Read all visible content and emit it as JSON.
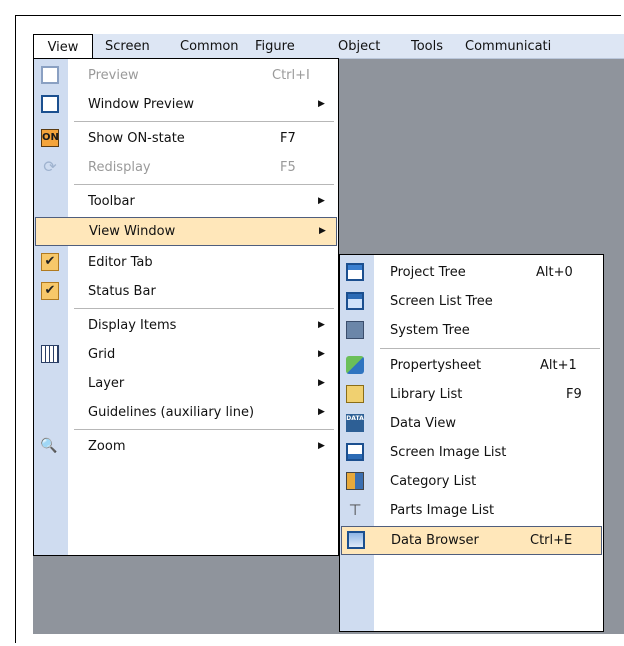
{
  "menubar": {
    "items": [
      "View",
      "Screen",
      "Common",
      "Figure",
      "Object",
      "Tools",
      "Communicati"
    ]
  },
  "view_menu": {
    "items": [
      {
        "label": "Preview",
        "shortcut": "Ctrl+I",
        "icon": "preview-icon",
        "disabled": true
      },
      {
        "label": "Window Preview",
        "submenu": true,
        "icon": "window-preview-icon"
      },
      {
        "label": "Show ON-state",
        "shortcut": "F7",
        "icon": "on-state-icon",
        "icon_text": "ON"
      },
      {
        "label": "Redisplay",
        "shortcut": "F5",
        "icon": "redisplay-icon",
        "disabled": true
      },
      {
        "label": "Toolbar",
        "submenu": true
      },
      {
        "label": "View Window",
        "submenu": true,
        "highlighted": true
      },
      {
        "label": "Editor Tab",
        "checked": true,
        "icon": "checkmark-icon"
      },
      {
        "label": "Status Bar",
        "checked": true,
        "icon": "checkmark-icon"
      },
      {
        "label": "Display Items",
        "submenu": true
      },
      {
        "label": "Grid",
        "submenu": true,
        "icon": "grid-icon"
      },
      {
        "label": "Layer",
        "submenu": true
      },
      {
        "label": "Guidelines (auxiliary line)",
        "submenu": true
      },
      {
        "label": "Zoom",
        "submenu": true,
        "icon": "zoom-icon"
      }
    ]
  },
  "view_window_submenu": {
    "items": [
      {
        "label": "Project Tree",
        "shortcut": "Alt+0",
        "icon": "project-tree-icon"
      },
      {
        "label": "Screen List Tree",
        "icon": "screen-list-tree-icon"
      },
      {
        "label": "System Tree",
        "icon": "system-tree-icon"
      },
      {
        "label": "Propertysheet",
        "shortcut": "Alt+1",
        "icon": "propertysheet-icon"
      },
      {
        "label": "Library List",
        "shortcut": "F9",
        "icon": "library-list-icon"
      },
      {
        "label": "Data View",
        "icon": "data-view-icon",
        "icon_text": "DATA"
      },
      {
        "label": "Screen Image List",
        "icon": "screen-image-list-icon"
      },
      {
        "label": "Category List",
        "icon": "category-list-icon"
      },
      {
        "label": "Parts Image List",
        "icon": "parts-image-list-icon"
      },
      {
        "label": "Data Browser",
        "shortcut": "Ctrl+E",
        "icon": "data-browser-icon",
        "highlighted": true
      }
    ]
  },
  "glyphs": {
    "checkmark": "✔",
    "submenu_arrow": "▶",
    "redisplay": "⟳",
    "zoom": "🔍",
    "pin": "⊤"
  },
  "colors": {
    "highlight": "#ffe7ba",
    "gutter": "#cfdcf0",
    "workspace": "#8f949c",
    "menubar": "#dde6f4"
  }
}
